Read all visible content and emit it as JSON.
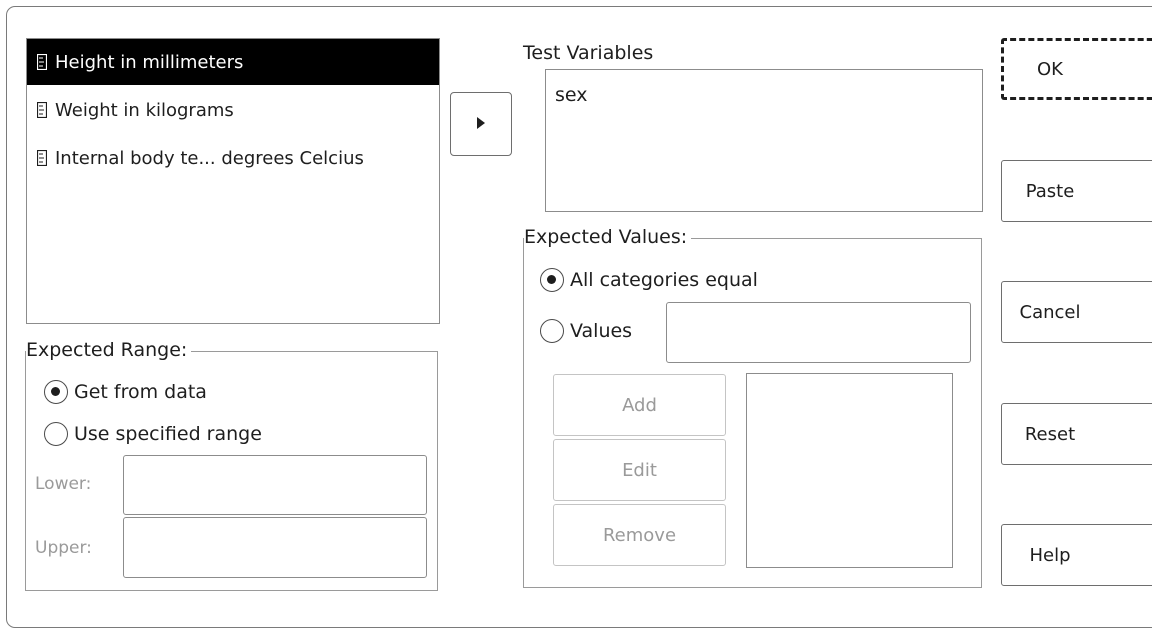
{
  "source_list": {
    "items": [
      {
        "label": "Height in millimeters",
        "icon": "scale-variable-icon",
        "selected": true
      },
      {
        "label": "Weight in kilograms",
        "icon": "scale-variable-icon",
        "selected": false
      },
      {
        "label": "Internal body te... degrees Celcius",
        "icon": "scale-variable-icon",
        "selected": false
      }
    ]
  },
  "move_button": {
    "icon": "right-triangle-arrow-icon"
  },
  "test_variables": {
    "label": "Test Variables",
    "items": [
      "sex"
    ]
  },
  "expected_range": {
    "title": "Expected Range:",
    "get_from_data": "Get from data",
    "use_specified": "Use specified range",
    "lower_label": "Lower:",
    "upper_label": "Upper:",
    "lower_value": "",
    "upper_value": "",
    "selected": "get_from_data"
  },
  "expected_values": {
    "title": "Expected Values:",
    "all_equal": "All categories equal",
    "values": "Values",
    "values_input": "",
    "selected": "all_equal",
    "add": "Add",
    "edit": "Edit",
    "remove": "Remove"
  },
  "buttons": {
    "ok": "OK",
    "paste": "Paste",
    "cancel": "Cancel",
    "reset": "Reset",
    "help": "Help"
  }
}
